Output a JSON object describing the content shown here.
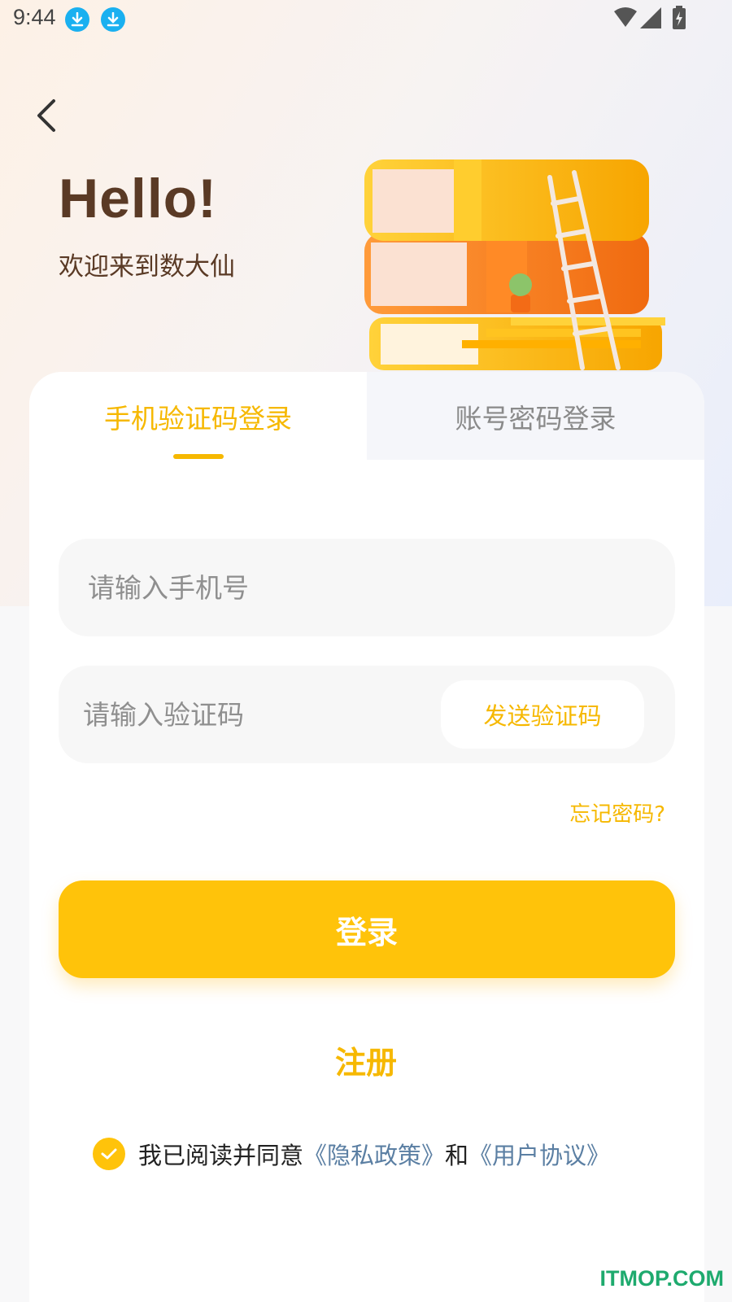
{
  "status_bar": {
    "time": "9:44",
    "icons": [
      "download-icon",
      "download-icon",
      "wifi-icon",
      "signal-icon",
      "battery-icon"
    ]
  },
  "header": {
    "back_icon": "chevron-left-icon",
    "greeting": "Hello!",
    "welcome": "欢迎来到数大仙",
    "illustration": "books-ladder-illustration"
  },
  "tabs": [
    {
      "label": "手机验证码登录",
      "active": true
    },
    {
      "label": "账号密码登录",
      "active": false
    }
  ],
  "form": {
    "phone_placeholder": "请输入手机号",
    "code_placeholder": "请输入验证码",
    "send_code_label": "发送验证码",
    "forgot_label": "忘记密码?",
    "login_label": "登录",
    "register_label": "注册"
  },
  "agreement": {
    "checked": true,
    "prefix": "我已阅读并同意",
    "privacy": "《隐私政策》",
    "and": "和",
    "terms": "《用户协议》"
  },
  "watermark": "ITMOP.COM",
  "colors": {
    "accent": "#ffc30a",
    "accent_text": "#f6b800",
    "brown": "#5a3a25",
    "link": "#5b7fa3"
  }
}
